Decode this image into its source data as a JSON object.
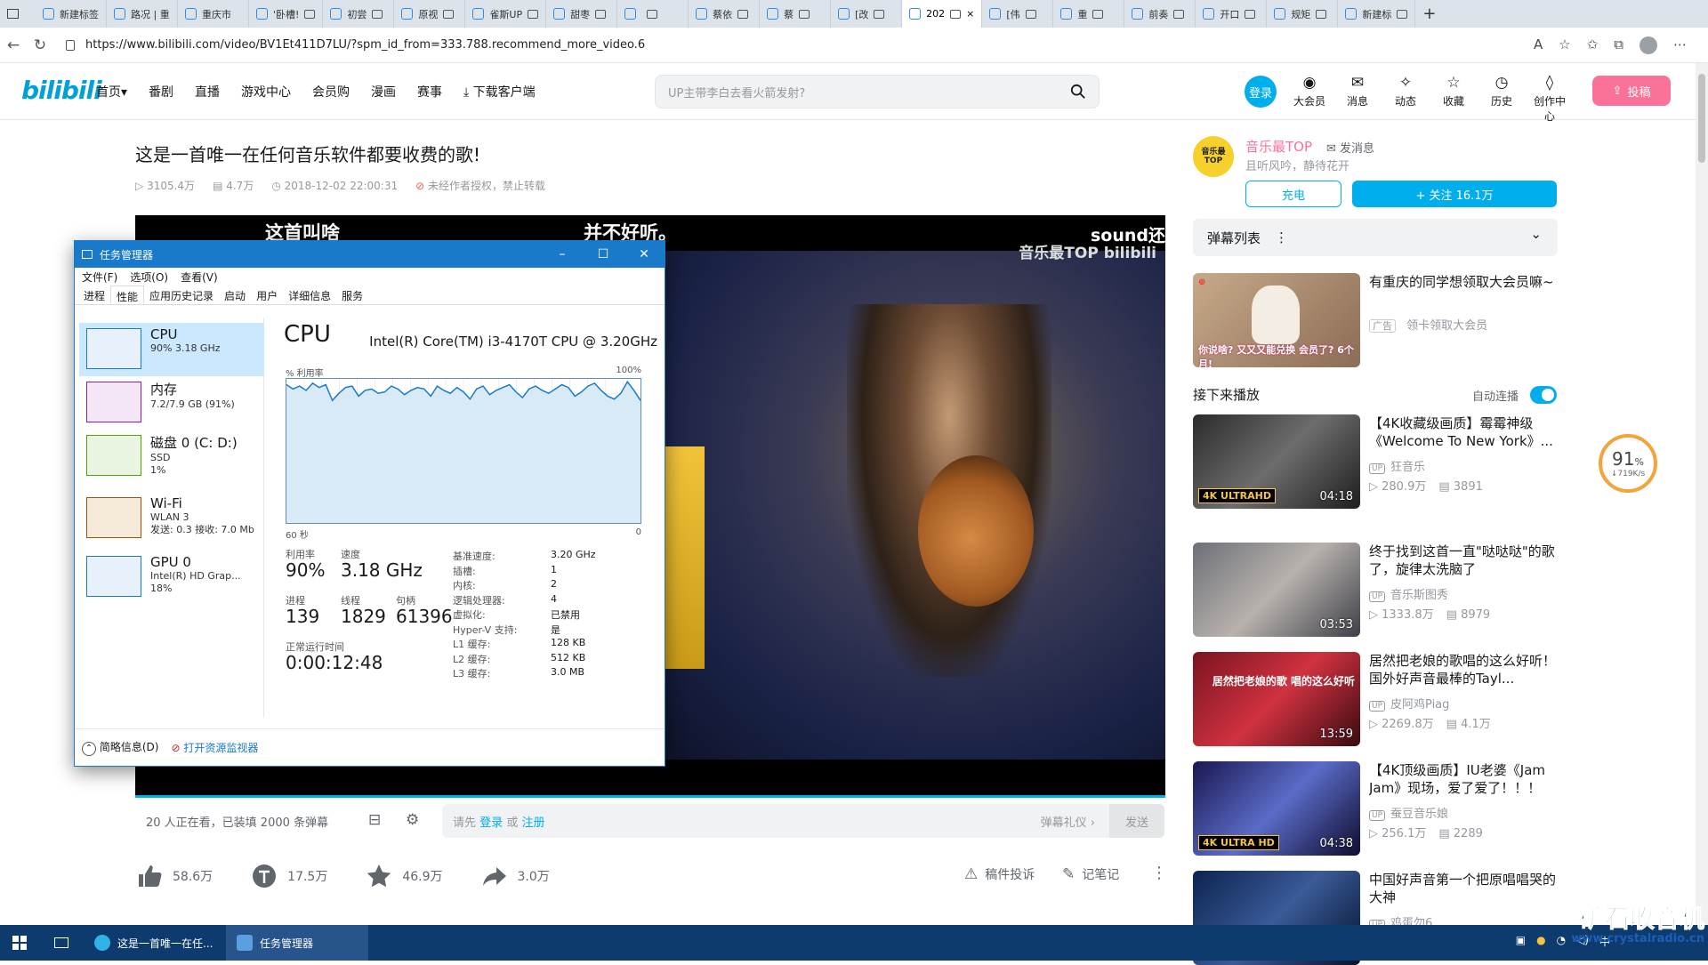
{
  "browser": {
    "tabs": [
      {
        "label": "新建标签",
        "active": false
      },
      {
        "label": "路况 | 重",
        "active": false
      },
      {
        "label": "重庆市",
        "active": false
      },
      {
        "label": "'卧槽!",
        "active": false
      },
      {
        "label": "初尝",
        "active": false
      },
      {
        "label": "原视",
        "active": false
      },
      {
        "label": "雀斯UP",
        "active": false
      },
      {
        "label": "甜枣",
        "active": false
      },
      {
        "label": "",
        "active": false
      },
      {
        "label": "蔡依",
        "active": false
      },
      {
        "label": "蔡",
        "active": false
      },
      {
        "label": "[改",
        "active": false
      },
      {
        "label": "202",
        "active": true
      },
      {
        "label": "[伟",
        "active": false
      },
      {
        "label": "重",
        "active": false
      },
      {
        "label": "前奏",
        "active": false
      },
      {
        "label": "开口",
        "active": false
      },
      {
        "label": "规矩",
        "active": false
      },
      {
        "label": "新建标",
        "active": false
      }
    ],
    "new_tab": "+",
    "url": "https://www.bilibili.com/video/BV1Et411D7LU/?spm_id_from=333.788.recommend_more_video.6"
  },
  "header": {
    "logo": "bilibili",
    "nav": [
      "首页",
      "番剧",
      "直播",
      "游戏中心",
      "会员购",
      "漫画",
      "赛事",
      "下载客户端"
    ],
    "nav_home_arrow": "▾",
    "search_placeholder": "UP主带李白去看火箭发射?",
    "login": "登录",
    "icons": [
      {
        "label": "大会员",
        "icon": "vip-icon"
      },
      {
        "label": "消息",
        "icon": "message-icon"
      },
      {
        "label": "动态",
        "icon": "dynamic-icon"
      },
      {
        "label": "收藏",
        "icon": "favorite-icon"
      },
      {
        "label": "历史",
        "icon": "history-icon"
      },
      {
        "label": "创作中心",
        "icon": "creator-icon"
      }
    ],
    "upload": "投稿"
  },
  "video": {
    "title": "这是一首唯一在任何音乐软件都要收费的歌!",
    "views": "3105.4万",
    "danmaku_count": "4.7万",
    "date": "2018-12-02 22:00:31",
    "copyright": "未经作者授权，禁止转载",
    "subtitle_left": "这首叫啥",
    "subtitle_mid": "并不好听。",
    "subtitle_right": "sound还",
    "watermark": "音乐最TOP bilibili"
  },
  "danmaku_bar": {
    "watching": "20 人正在看，已装填 2000 条弹幕",
    "input_prefix": "请先",
    "login": "登录",
    "or": "或",
    "register": "注册",
    "etiquette": "弹幕礼仪 ›",
    "send": "发送"
  },
  "toolbar": {
    "like": "58.6万",
    "coin": "17.5万",
    "favorite": "46.9万",
    "share": "3.0万",
    "report": "稿件投诉",
    "note": "记笔记",
    "more": "⋮"
  },
  "up": {
    "avatar_text": "音乐最 TOP",
    "name": "音乐最TOP",
    "message": "发消息",
    "desc": "且听风吟，静待花开",
    "charge": "充电",
    "follow": "+ 关注 16.1万"
  },
  "danmaku_list": {
    "label": "弹幕列表",
    "menu": "⋮",
    "chevron": "⌄"
  },
  "ad": {
    "title": "有重庆的同学想领取大会员嘛~",
    "tag": "广告",
    "sub": "领卡领取大会员",
    "thumb_text": "你说啥? 又又又能兑换 会员了? 6个月!"
  },
  "next": {
    "label": "接下来播放",
    "autoplay": "自动连播"
  },
  "recommend": [
    {
      "title": "【4K收藏级画质】霉霉神级《Welcome To New York》...",
      "up": "狂音乐",
      "views": "280.9万",
      "danmaku": "3891",
      "duration": "04:18",
      "badge": "4K ULTRAHD"
    },
    {
      "title": "终于找到这首一直\"哒哒哒\"的歌了，旋律太洗脑了",
      "up": "音乐斯图秀",
      "views": "1333.8万",
      "danmaku": "8979",
      "duration": "03:53",
      "badge": ""
    },
    {
      "title": "居然把老娘的歌唱的这么好听！国外好声音最棒的Tayl...",
      "up": "皮阿鸡Piag",
      "views": "2269.8万",
      "danmaku": "4.1万",
      "duration": "13:59",
      "badge": "居然把老娘的歌 唱的这么好听"
    },
    {
      "title": "【4K顶级画质】IU老婆《Jam Jam》现场，爱了爱了！！！",
      "up": "蚕豆音乐娘",
      "views": "256.1万",
      "danmaku": "2289",
      "duration": "04:38",
      "badge": "4K ULTRA HD"
    },
    {
      "title": "中国好声音第一个把原唱唱哭的大神",
      "up": "鸡蛋勿6",
      "views": "",
      "danmaku": "",
      "duration": "",
      "badge": ""
    }
  ],
  "speed_widget": {
    "percent": "91",
    "pct_sign": "%",
    "rate": "↓719K/s"
  },
  "taskmgr": {
    "title": "任务管理器",
    "menu": [
      "文件(F)",
      "选项(O)",
      "查看(V)"
    ],
    "tabs": [
      "进程",
      "性能",
      "应用历史记录",
      "启动",
      "用户",
      "详细信息",
      "服务"
    ],
    "active_tab": 1,
    "resources": [
      {
        "name": "CPU",
        "sub1": "90% 3.18 GHz",
        "sub2": "",
        "sub3": "",
        "color": "#1979ca"
      },
      {
        "name": "内存",
        "sub1": "7.2/7.9 GB (91%)",
        "sub2": "",
        "sub3": "",
        "color": "#8b1fa9"
      },
      {
        "name": "磁盘 0 (C: D:)",
        "sub1": "SSD",
        "sub2": "1%",
        "sub3": "",
        "color": "#4da60c"
      },
      {
        "name": "Wi-Fi",
        "sub1": "WLAN 3",
        "sub2": "发送: 0.3 接收: 7.0 Mb",
        "sub3": "",
        "color": "#a74f01"
      },
      {
        "name": "GPU 0",
        "sub1": "Intel(R) HD Grap...",
        "sub2": "18%",
        "sub3": "",
        "color": "#1979ca"
      }
    ],
    "cpu_heading": "CPU",
    "cpu_model": "Intel(R) Core(TM) i3-4170T CPU @ 3.20GHz",
    "graph_label": "% 利用率",
    "graph_max": "100%",
    "graph_time": "60 秒",
    "graph_zero": "0",
    "graph_values": [
      96,
      93,
      95,
      92,
      97,
      94,
      96,
      85,
      90,
      94,
      95,
      88,
      92,
      93,
      90,
      91,
      95,
      93,
      89,
      92,
      94,
      93,
      88,
      95,
      92,
      90,
      94,
      91,
      86,
      93,
      95,
      89,
      92,
      94,
      96,
      91,
      87,
      93,
      95,
      92,
      90,
      93,
      96,
      94,
      88,
      91,
      95,
      97,
      92,
      88,
      86,
      90,
      98,
      92,
      85
    ],
    "utilization_label": "利用率",
    "utilization": "90%",
    "speed_label": "速度",
    "speed": "3.18 GHz",
    "processes_label": "进程",
    "processes": "139",
    "threads_label": "线程",
    "threads": "1829",
    "handles_label": "句柄",
    "handles": "61396",
    "uptime_label": "正常运行时间",
    "uptime": "0:00:12:48",
    "specs": [
      {
        "k": "基准速度:",
        "v": "3.20 GHz"
      },
      {
        "k": "插槽:",
        "v": "1"
      },
      {
        "k": "内核:",
        "v": "2"
      },
      {
        "k": "逻辑处理器:",
        "v": "4"
      },
      {
        "k": "虚拟化:",
        "v": "已禁用"
      },
      {
        "k": "Hyper-V 支持:",
        "v": "是"
      },
      {
        "k": "L1 缓存:",
        "v": "128 KB"
      },
      {
        "k": "L2 缓存:",
        "v": "512 KB"
      },
      {
        "k": "L3 缓存:",
        "v": "3.0 MB"
      }
    ],
    "footer_brief": "简略信息(D)",
    "footer_monitor": "打开资源监视器"
  },
  "taskbar": {
    "items": [
      {
        "label": "这是一首唯一在任...",
        "active": false
      },
      {
        "label": "任务管理器",
        "active": true
      }
    ],
    "tray_lang": "中"
  },
  "stamp": {
    "main": "矿石收音机",
    "url": "www.crystalradio.cn"
  }
}
